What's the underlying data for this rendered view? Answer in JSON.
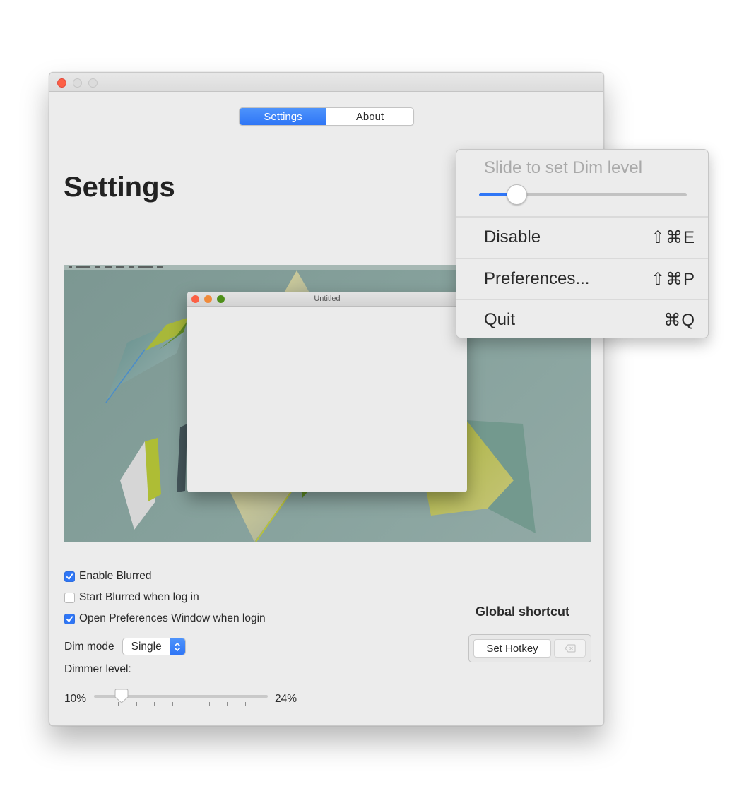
{
  "window": {
    "tabs": [
      {
        "label": "Settings",
        "active": true
      },
      {
        "label": "About",
        "active": false
      }
    ],
    "page_title": "Settings",
    "preview": {
      "mini_window_title": "Untitled"
    },
    "checkboxes": [
      {
        "label": "Enable Blurred",
        "checked": true
      },
      {
        "label": "Start Blurred when log in",
        "checked": false
      },
      {
        "label": "Open Preferences Window when login",
        "checked": true
      }
    ],
    "dim_mode": {
      "label": "Dim mode",
      "value": "Single"
    },
    "dimmer_level": {
      "label": "Dimmer level:",
      "min_label": "10%",
      "max_label": "24%",
      "value_fraction": 0.16,
      "tick_count": 10
    },
    "global_shortcut": {
      "title": "Global shortcut",
      "set_hotkey_label": "Set Hotkey",
      "clear_icon": "delete-left-icon"
    }
  },
  "status_menu": {
    "slider_label": "Slide to set Dim level",
    "slider_value_fraction": 0.18,
    "items": [
      {
        "label": "Disable",
        "shortcut": "⇧⌘E"
      },
      {
        "label": "Preferences...",
        "shortcut": "⇧⌘P"
      },
      {
        "label": "Quit",
        "shortcut": "⌘Q"
      }
    ]
  },
  "colors": {
    "accent": "#2f76f6",
    "close_button": "#fc6045",
    "desktop_bg": "#88a39e"
  }
}
